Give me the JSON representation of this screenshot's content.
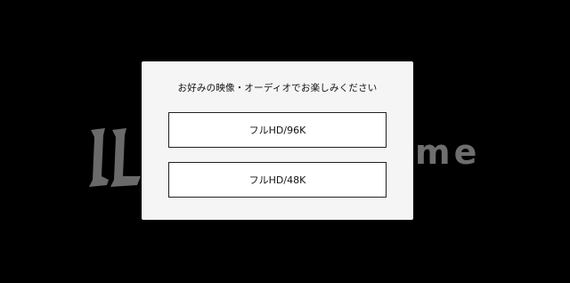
{
  "background": {
    "logo_text": "me",
    "logo_mark": "stylized-ll-logo-mark",
    "color": "#000000"
  },
  "dialog": {
    "title": "お好みの映像・オーディオでお楽しみください",
    "options": [
      {
        "label": "フルHD/96K"
      },
      {
        "label": "フルHD/48K"
      }
    ]
  }
}
